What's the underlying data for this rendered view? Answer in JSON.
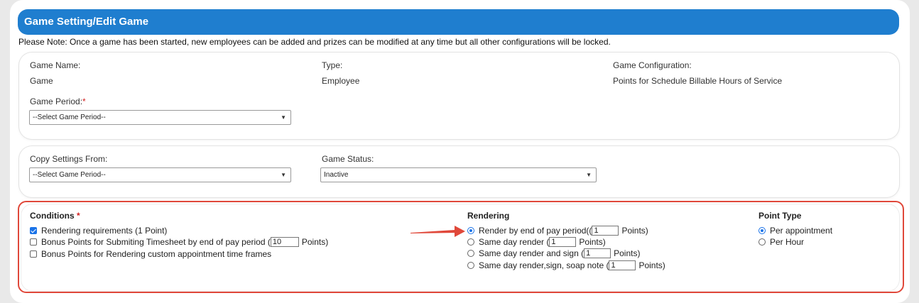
{
  "header": {
    "title": "Game Setting/Edit Game"
  },
  "note": "Please Note: Once a game has been started, new employees can be added and prizes can be modified at any time but all other configurations will be locked.",
  "card1": {
    "game_name_label": "Game Name:",
    "game_name_value": "Game",
    "type_label": "Type:",
    "type_value": "Employee",
    "config_label": "Game Configuration:",
    "config_value": "Points for Schedule Billable Hours of Service",
    "period_label": "Game Period:",
    "required_mark": "*",
    "period_select": "--Select Game Period--"
  },
  "card2": {
    "copy_label": "Copy Settings From:",
    "copy_select": "--Select Game Period--",
    "status_label": "Game Status:",
    "status_select": "Inactive"
  },
  "conditions": {
    "title": "Conditions",
    "required_mark": "*",
    "items": [
      {
        "label": "Rendering requirements (1 Point)",
        "checked": true
      },
      {
        "label_pre": "Bonus Points for Submiting Timesheet by end of pay period (",
        "value": "10",
        "label_post": "Points)",
        "checked": false
      },
      {
        "label": "Bonus Points for Rendering custom appointment time frames",
        "checked": false
      }
    ]
  },
  "rendering": {
    "title": "Rendering",
    "items": [
      {
        "label_pre": "Render by end of pay period((",
        "value": "1",
        "label_post": "Points)",
        "checked": true
      },
      {
        "label_pre": "Same day render (",
        "value": "1",
        "label_post": "Points)",
        "checked": false
      },
      {
        "label_pre": "Same day render and sign (",
        "value": "1",
        "label_post": "Points)",
        "checked": false
      },
      {
        "label_pre": "Same day render,sign, soap note (",
        "value": "1",
        "label_post": "Points)",
        "checked": false
      }
    ]
  },
  "point_type": {
    "title": "Point Type",
    "items": [
      {
        "label": "Per appointment",
        "checked": true
      },
      {
        "label": "Per Hour",
        "checked": false
      }
    ]
  },
  "colors": {
    "accent": "#1f7ecf",
    "highlight": "#e0483a",
    "checkbox": "#1a73e8"
  },
  "icons": {
    "caret": "chevron-down-icon",
    "arrow": "red-arrow-icon"
  }
}
